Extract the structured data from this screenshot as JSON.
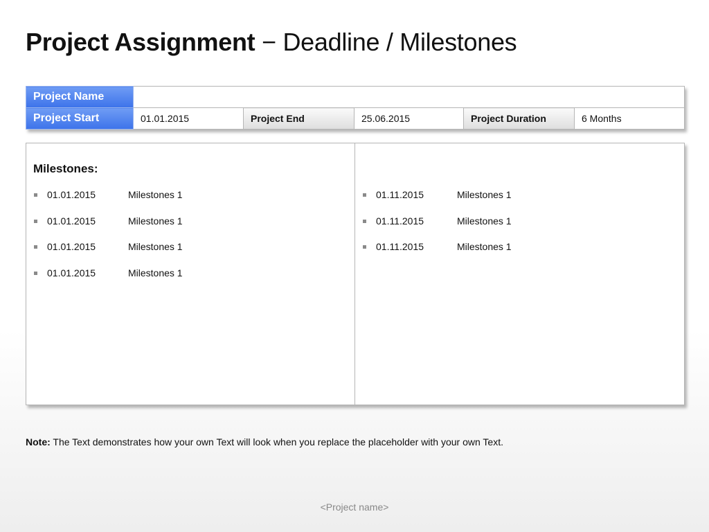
{
  "title": {
    "bold": "Project Assignment",
    "rest": " − Deadline / Milestones"
  },
  "info": {
    "project_name_label": "Project Name",
    "project_name_value": "",
    "project_start_label": "Project Start",
    "project_start_value": "01.01.2015",
    "project_end_label": "Project End",
    "project_end_value": "25.06.2015",
    "project_duration_label": "Project Duration",
    "project_duration_value": "6 Months"
  },
  "milestones": {
    "heading": "Milestones:",
    "left": [
      {
        "date": "01.01.2015",
        "label": "Milestones 1"
      },
      {
        "date": "01.01.2015",
        "label": "Milestones 1"
      },
      {
        "date": "01.01.2015",
        "label": "Milestones 1"
      },
      {
        "date": "01.01.2015",
        "label": "Milestones 1"
      }
    ],
    "right": [
      {
        "date": "01.11.2015",
        "label": "Milestones 1"
      },
      {
        "date": "01.11.2015",
        "label": "Milestones 1"
      },
      {
        "date": "01.11.2015",
        "label": "Milestones 1"
      }
    ]
  },
  "note": {
    "label": "Note:",
    "text": " The Text demonstrates how your own Text will look when you replace the placeholder with your own Text."
  },
  "footer": "<Project name>",
  "colors": {
    "header_blue": "#3d73ea",
    "bullet_grey": "#8a8a8a",
    "border_grey": "#b5b5b5"
  }
}
